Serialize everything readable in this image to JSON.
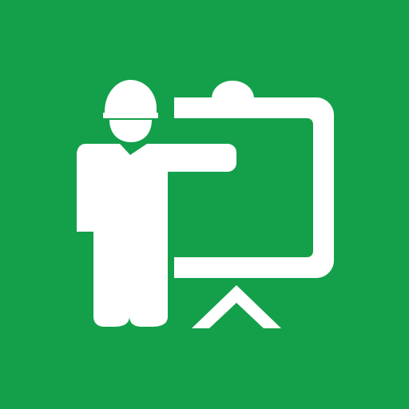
{
  "icon": {
    "name": "safety-training-presentation-icon",
    "background_color": "#14A04B",
    "foreground_color": "#FFFFFF",
    "elements": [
      "hard-hat-icon",
      "worker-figure-icon",
      "presentation-board-icon",
      "easel-stand-icon"
    ]
  }
}
